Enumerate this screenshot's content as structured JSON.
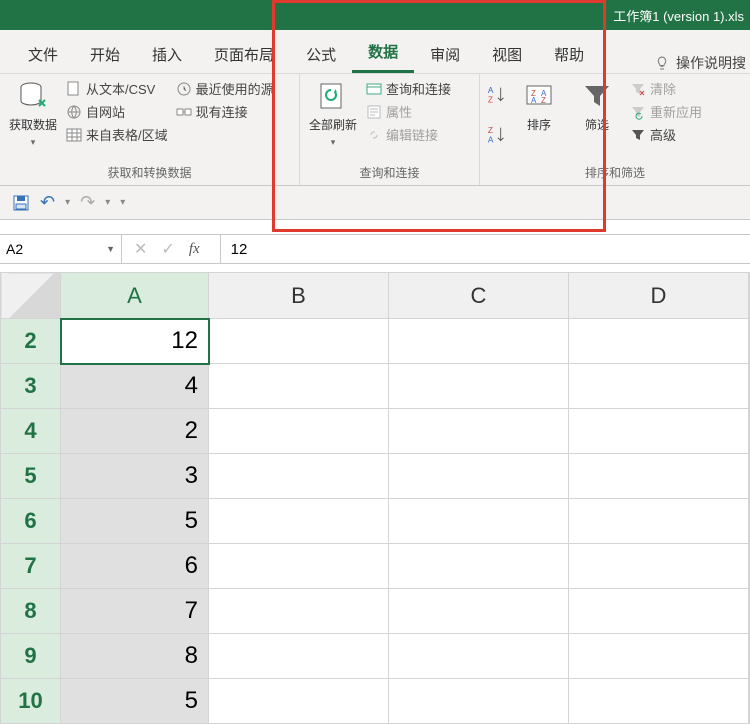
{
  "title": "工作簿1 (version 1).xls",
  "tabs": {
    "file": "文件",
    "home": "开始",
    "insert": "插入",
    "layout": "页面布局",
    "formula": "公式",
    "data": "数据",
    "review": "审阅",
    "view": "视图",
    "help": "帮助"
  },
  "tellme": "操作说明搜",
  "ribbon": {
    "getdata": {
      "big": "获取数据",
      "small1": "从文本/CSV",
      "small2": "自网站",
      "small3": "来自表格/区域",
      "small4": "最近使用的源",
      "small5": "现有连接",
      "group_label": "获取和转换数据"
    },
    "queries": {
      "big": "全部刷新",
      "s1": "查询和连接",
      "s2": "属性",
      "s3": "编辑链接",
      "group_label": "查询和连接"
    },
    "sort": {
      "big": "排序",
      "filter": "筛选",
      "s1": "清除",
      "s2": "重新应用",
      "s3": "高级",
      "group_label": "排序和筛选"
    }
  },
  "namebox": "A2",
  "formula_value": "12",
  "columns": [
    "A",
    "B",
    "C",
    "D"
  ],
  "rows": [
    {
      "n": "2",
      "v": "12"
    },
    {
      "n": "3",
      "v": "4"
    },
    {
      "n": "4",
      "v": "2"
    },
    {
      "n": "5",
      "v": "3"
    },
    {
      "n": "6",
      "v": "5"
    },
    {
      "n": "7",
      "v": "6"
    },
    {
      "n": "8",
      "v": "7"
    },
    {
      "n": "9",
      "v": "8"
    },
    {
      "n": "10",
      "v": "5"
    }
  ]
}
